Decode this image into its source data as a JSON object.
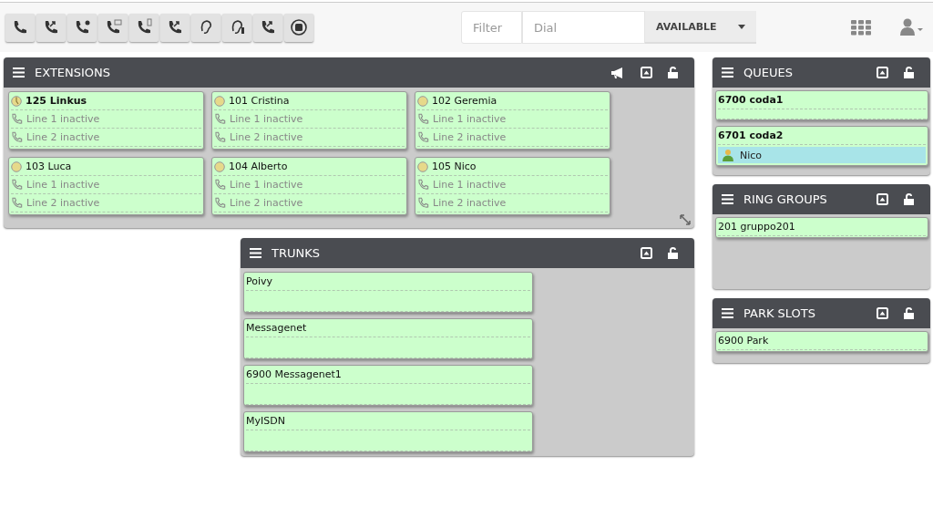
{
  "toolbar": {
    "filter": {
      "placeholder": "Filter"
    },
    "dial": {
      "placeholder": "Dial"
    },
    "status": "AVAILABLE"
  },
  "extensions": {
    "title": "EXTENSIONS",
    "items": [
      {
        "name": "125 Linkus",
        "current": true,
        "lines": [
          "Line 1 inactive",
          "Line 2 inactive"
        ]
      },
      {
        "name": "101 Cristina",
        "current": false,
        "lines": [
          "Line 1 inactive",
          "Line 2 inactive"
        ]
      },
      {
        "name": "102 Geremia",
        "current": false,
        "lines": [
          "Line 1 inactive",
          "Line 2 inactive"
        ]
      },
      {
        "name": "103 Luca",
        "current": false,
        "lines": [
          "Line 1 inactive",
          "Line 2 inactive"
        ]
      },
      {
        "name": "104 Alberto",
        "current": false,
        "lines": [
          "Line 1 inactive",
          "Line 2 inactive"
        ]
      },
      {
        "name": "105 Nico",
        "current": false,
        "lines": [
          "Line 1 inactive",
          "Line 2 inactive"
        ]
      }
    ]
  },
  "trunks": {
    "title": "TRUNKS",
    "items": [
      "Poivy",
      "Messagenet",
      "6900 Messagenet1",
      "MyISDN"
    ]
  },
  "queues": {
    "title": "QUEUES",
    "items": [
      {
        "name": "6700 coda1"
      },
      {
        "name": "6701 coda2",
        "members": [
          "Nico"
        ]
      }
    ]
  },
  "ring_groups": {
    "title": "RING GROUPS",
    "items": [
      "201 gruppo201"
    ]
  },
  "park_slots": {
    "title": "PARK SLOTS",
    "items": [
      "6900 Park"
    ]
  }
}
